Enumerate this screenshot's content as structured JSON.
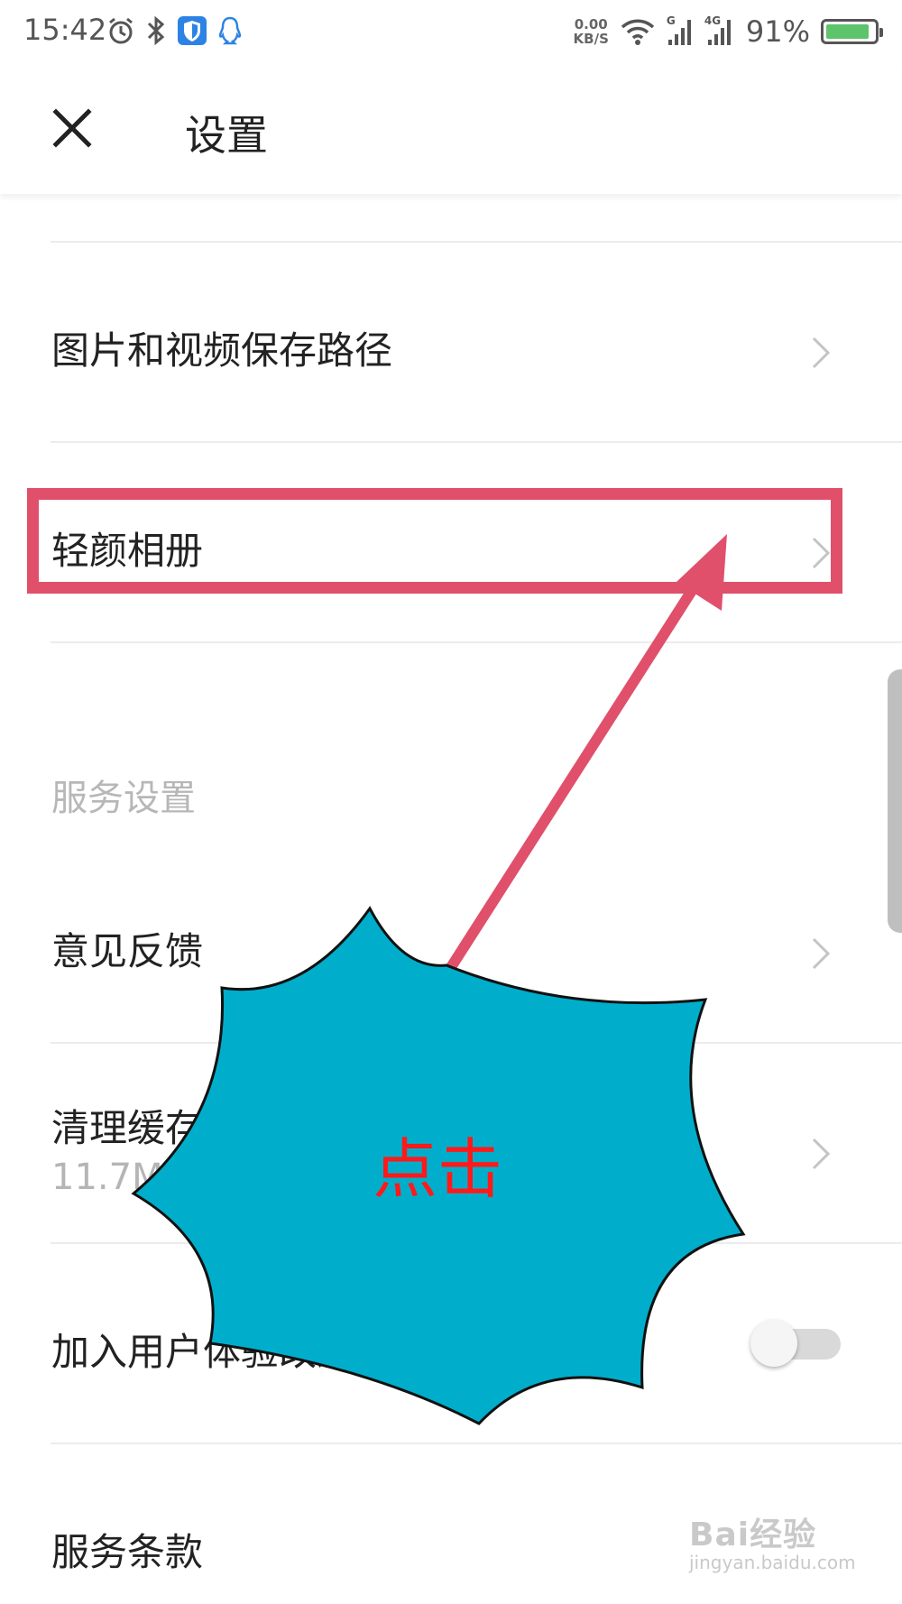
{
  "status_bar": {
    "time": "15:42",
    "net_speed_value": "0.00",
    "net_speed_unit": "KB/S",
    "signal_1_label": "G",
    "signal_2_label": "4G",
    "battery_percent": "91%",
    "battery_level": 0.91,
    "icons": [
      "alarm-icon",
      "bluetooth-icon",
      "shield-app-icon",
      "qq-icon",
      "wifi-icon",
      "cell-signal-icon",
      "battery-icon"
    ]
  },
  "header": {
    "close_icon": "close-icon",
    "title": "设置"
  },
  "rows": {
    "save_path": "图片和视频保存路径",
    "album": "轻颜相册",
    "section_service": "服务设置",
    "feedback": "意见反馈",
    "clear_cache": "清理缓存",
    "cache_size": "11.7M",
    "ux_program": "加入用户体验改进计划",
    "ux_program_enabled": false,
    "terms": "服务条款"
  },
  "annotation": {
    "callout_text": "点击",
    "highlight_color": "#e0506b",
    "burst_color": "#00aecc",
    "text_color": "#ff1a1a"
  },
  "watermark": {
    "main": "Bai经验",
    "sub": "jingyan.baidu.com"
  },
  "colors": {
    "divider": "#ececec",
    "section_text": "#b7b7b7",
    "toggle_track": "#d9d9d9",
    "toggle_knob": "#f5f5f5"
  }
}
